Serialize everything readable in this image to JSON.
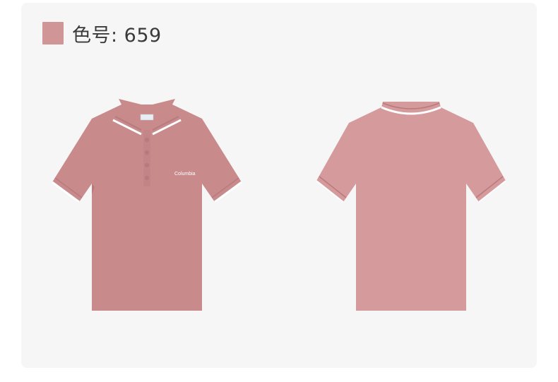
{
  "color_label": "色号: 659",
  "colors": {
    "swatch": "#cf9597",
    "shirt": "#c98a8c",
    "shirt_back": "#d59a9b",
    "shirt_shade": "#b87a7d",
    "trim": "#ffffff",
    "background": "#f6f6f6"
  },
  "products": {
    "front": {
      "view": "front",
      "logo_text": "Columbia",
      "buttons": 4
    },
    "back": {
      "view": "back"
    }
  }
}
